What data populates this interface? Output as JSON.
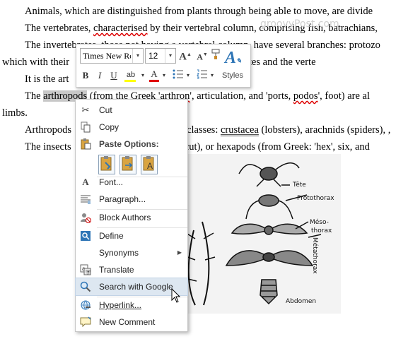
{
  "document": {
    "lines": [
      {
        "text": "Animals, which are distinguished from plants through being able to move, are divide"
      },
      {
        "a": "The vertebrates, ",
        "b": "characterised",
        "c": " by their vertebral column, comprising fish, batrachians,"
      },
      {
        "text": "The invertebrates, those not having a vertebral column, have several branches: protozo"
      },
      {
        "a": "which with their",
        "b": "een the invertebrates and the verte"
      },
      {
        "text": "It is the art"
      },
      {
        "a": "The ",
        "b": "arthropods",
        "c": " (from the Greek '",
        "d": "arthron",
        "e": "', articulation, and 'ports, ",
        "f": "podos",
        "g": "', foot) are al"
      },
      {
        "text": "limbs."
      },
      {
        "a": "Arthropods",
        "b": "classes: ",
        "c": "crustacea",
        "d": " (lobsters), arachnids (spiders), ,"
      },
      {
        "a": "The insects",
        "b": "re",
        "c": "', cut), or hexapods (from Greek: 'hex', six, and"
      }
    ],
    "watermark": "groovyPost.com"
  },
  "figure": {
    "labels": [
      "Tête",
      "Protothorax",
      "Méso-",
      "thorax",
      "Métathorax",
      "Abdomen"
    ]
  },
  "mini_toolbar": {
    "font_name": "Times New Roman",
    "font_size": "12",
    "dropdown": "▾",
    "bold": "B",
    "italic": "I",
    "underline": "U",
    "highlight": "ab",
    "font_color": "A",
    "styles_label": "Styles"
  },
  "context_menu": {
    "cut": "Cut",
    "copy": "Copy",
    "paste_options": "Paste Options:",
    "font": "Font...",
    "paragraph": "Paragraph...",
    "block_authors": "Block Authors",
    "define": "Define",
    "synonyms": "Synonyms",
    "translate": "Translate",
    "search_google": "Search with Google",
    "hyperlink": "Hyperlink...",
    "new_comment": "New Comment",
    "submenu_arrow": "▶"
  },
  "colors": {
    "accent": "#2e75b6",
    "hover": "#dde7f1",
    "font_color_bar": "#e00000",
    "highlight_bar": "#ffff00"
  }
}
